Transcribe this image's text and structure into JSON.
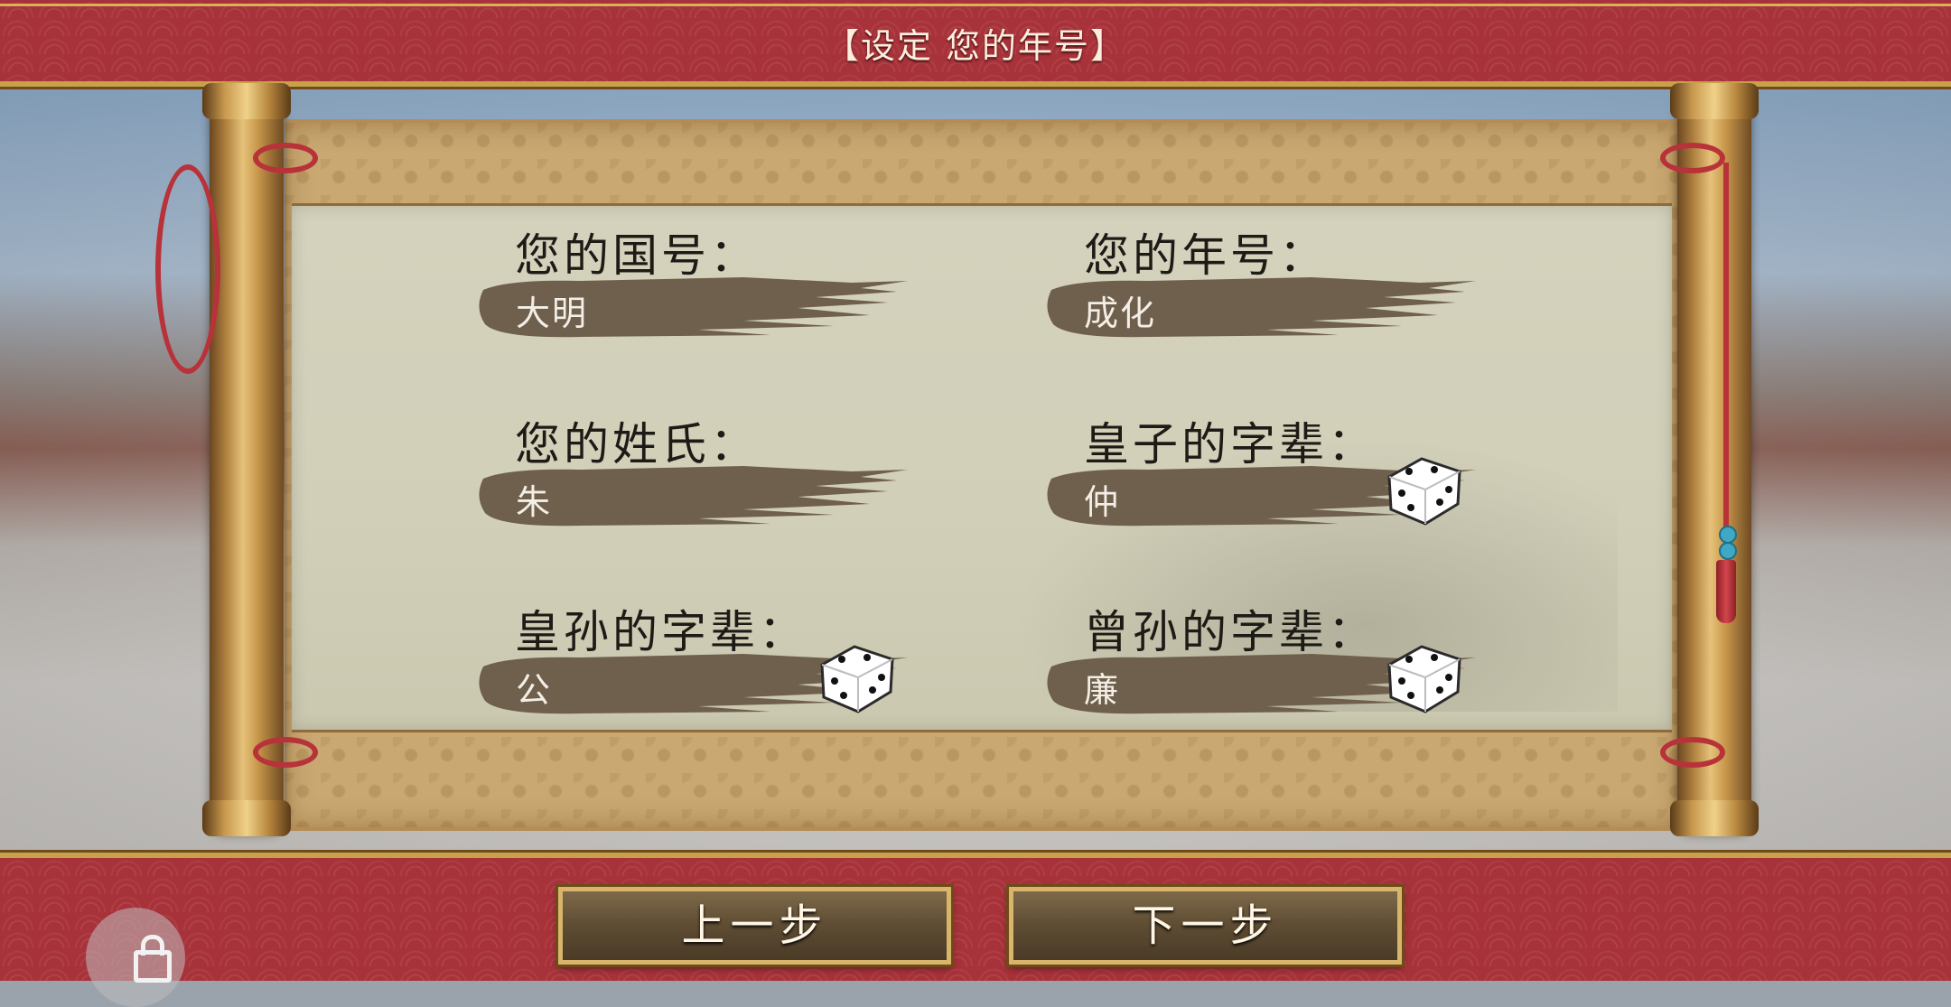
{
  "title": "【设定 您的年号】",
  "fields": [
    {
      "label": "您的国号：",
      "value": "大明",
      "has_dice": false
    },
    {
      "label": "您的年号：",
      "value": "成化",
      "has_dice": false
    },
    {
      "label": "您的姓氏：",
      "value": "朱",
      "has_dice": false
    },
    {
      "label": "皇子的字辈：",
      "value": "仲",
      "has_dice": true
    },
    {
      "label": "皇孙的字辈：",
      "value": "公",
      "has_dice": true
    },
    {
      "label": "曾孙的字辈：",
      "value": "廉",
      "has_dice": true
    }
  ],
  "buttons": {
    "prev": "上一步",
    "next": "下一步"
  },
  "icons": {
    "dice": "dice-icon",
    "lock": "lock-icon"
  },
  "colors": {
    "banner": "#a8323a",
    "gold_trim": "#c9a14a",
    "ink_brush": "#6f5f4d",
    "paper": "#d4d2bc"
  }
}
